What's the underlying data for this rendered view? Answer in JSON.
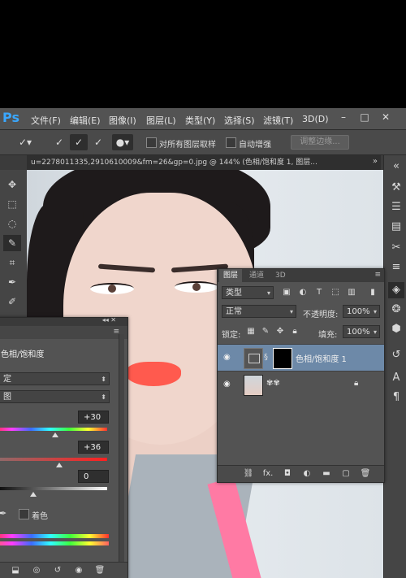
{
  "app": {
    "logo": "Ps"
  },
  "menu": [
    "文件(F)",
    "编辑(E)",
    "图像(I)",
    "图层(L)",
    "类型(Y)",
    "选择(S)",
    "滤镜(T)",
    "3D(D)"
  ],
  "window_controls": {
    "minimize": "–",
    "maximize": "□",
    "close": "✕"
  },
  "options_bar": {
    "sample_all_layers": "对所有图层取样",
    "auto_enhance": "自动增强",
    "refine_edge": "调整边缘..."
  },
  "document": {
    "tab_title": "u=2278011335,2910610009&fm=26&gp=0.jpg @ 144% (色相/饱和度 1, 图层...",
    "collapse": "»"
  },
  "layers_panel": {
    "tabs": [
      "图层",
      "通道",
      "3D"
    ],
    "filter_kind": "类型",
    "blend_mode": "正常",
    "opacity_label": "不透明度:",
    "opacity_value": "100%",
    "lock_label": "锁定:",
    "fill_label": "填充:",
    "fill_value": "100%",
    "layers": [
      {
        "name": "色相/饱和度 1",
        "selected": true
      },
      {
        "name": "",
        "selected": false
      }
    ],
    "footer_icons": [
      "link-icon",
      "fx-icon",
      "mask-icon",
      "adjustment-icon",
      "folder-icon",
      "new-layer-icon",
      "trash-icon"
    ],
    "fx_label": "fx."
  },
  "properties_panel": {
    "title": "色相/饱和度",
    "preset_value": "定",
    "channel_value": "图",
    "hue_value": "+30",
    "saturation_value": "+36",
    "lightness_value": "0",
    "colorize_label": "着色"
  },
  "colors": {
    "accent": "#3aa7ff",
    "selected_layer": "#6d89a8",
    "panel_bg": "#535353"
  }
}
